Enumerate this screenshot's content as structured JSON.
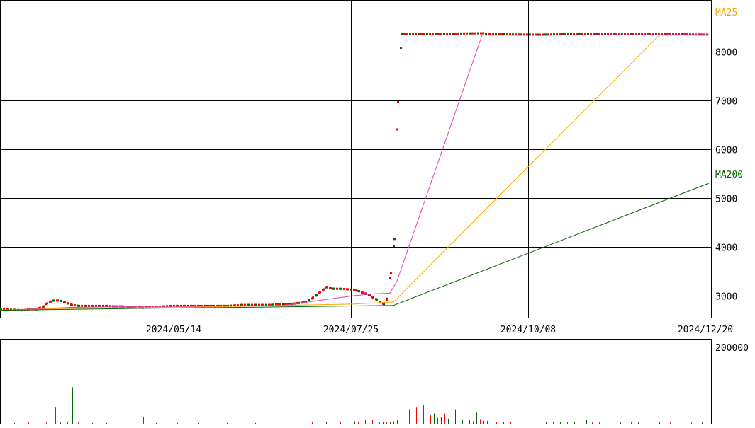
{
  "chart_data": [
    {
      "type": "candlestick",
      "panel": "price",
      "x_tick_labels": [
        "2024/05/14",
        "2024/07/25",
        "2024/10/08",
        "2024/12/20"
      ],
      "y_tick_labels": [
        "3000",
        "4000",
        "5000",
        "6000",
        "7000",
        "8000"
      ],
      "ylim": [
        2550,
        9050
      ],
      "grid": true,
      "legend": [
        "MA25",
        "MA200"
      ],
      "colors": {
        "up": "#ff0000",
        "down": "#006400",
        "ma_short": "#e040b0",
        "ma25": "#ffa500",
        "ma200": "#006400"
      },
      "prices": [
        [
          0,
          2720
        ],
        [
          10,
          2715
        ],
        [
          20,
          2710
        ],
        [
          30,
          2700
        ],
        [
          40,
          2720
        ],
        [
          50,
          2720
        ],
        [
          55,
          2750
        ],
        [
          60,
          2780
        ],
        [
          65,
          2840
        ],
        [
          70,
          2880
        ],
        [
          75,
          2900
        ],
        [
          80,
          2900
        ],
        [
          85,
          2890
        ],
        [
          90,
          2860
        ],
        [
          95,
          2840
        ],
        [
          100,
          2810
        ],
        [
          110,
          2790
        ],
        [
          120,
          2790
        ],
        [
          130,
          2790
        ],
        [
          140,
          2790
        ],
        [
          150,
          2790
        ],
        [
          160,
          2780
        ],
        [
          170,
          2780
        ],
        [
          180,
          2770
        ],
        [
          190,
          2770
        ],
        [
          200,
          2750
        ],
        [
          210,
          2770
        ],
        [
          220,
          2770
        ],
        [
          230,
          2780
        ],
        [
          240,
          2790
        ],
        [
          250,
          2790
        ],
        [
          260,
          2790
        ],
        [
          270,
          2790
        ],
        [
          280,
          2790
        ],
        [
          290,
          2790
        ],
        [
          300,
          2790
        ],
        [
          310,
          2790
        ],
        [
          320,
          2790
        ],
        [
          330,
          2800
        ],
        [
          340,
          2810
        ],
        [
          350,
          2810
        ],
        [
          360,
          2810
        ],
        [
          370,
          2810
        ],
        [
          380,
          2810
        ],
        [
          390,
          2820
        ],
        [
          400,
          2820
        ],
        [
          410,
          2830
        ],
        [
          420,
          2850
        ],
        [
          430,
          2870
        ],
        [
          440,
          2960
        ],
        [
          445,
          3010
        ],
        [
          450,
          3070
        ],
        [
          455,
          3130
        ],
        [
          460,
          3180
        ],
        [
          465,
          3150
        ],
        [
          470,
          3140
        ],
        [
          480,
          3140
        ],
        [
          490,
          3130
        ],
        [
          500,
          3120
        ],
        [
          505,
          3090
        ],
        [
          510,
          3060
        ],
        [
          515,
          3040
        ],
        [
          520,
          3010
        ],
        [
          525,
          2960
        ],
        [
          530,
          2920
        ],
        [
          535,
          2860
        ],
        [
          540,
          2830
        ],
        [
          545,
          2940
        ],
        [
          550,
          3460
        ],
        [
          555,
          4160
        ],
        [
          560,
          6960
        ],
        [
          565,
          8350
        ],
        [
          680,
          8370
        ],
        [
          690,
          8350
        ],
        [
          760,
          8340
        ],
        [
          800,
          8350
        ],
        [
          900,
          8360
        ],
        [
          1000,
          8340
        ]
      ],
      "ma_short": [
        [
          0,
          2700
        ],
        [
          100,
          2760
        ],
        [
          200,
          2780
        ],
        [
          300,
          2780
        ],
        [
          400,
          2800
        ],
        [
          460,
          2920
        ],
        [
          500,
          3000
        ],
        [
          530,
          3040
        ],
        [
          550,
          3050
        ],
        [
          560,
          3300
        ],
        [
          680,
          8330
        ],
        [
          1000,
          8340
        ]
      ],
      "ma25": [
        [
          0,
          2700
        ],
        [
          100,
          2740
        ],
        [
          300,
          2770
        ],
        [
          500,
          2830
        ],
        [
          555,
          2870
        ],
        [
          930,
          8330
        ],
        [
          1000,
          8330
        ]
      ],
      "ma200": [
        [
          0,
          2700
        ],
        [
          200,
          2740
        ],
        [
          400,
          2770
        ],
        [
          555,
          2800
        ],
        [
          1000,
          5300
        ]
      ]
    },
    {
      "type": "bar",
      "panel": "volume",
      "y_tick_labels": [
        "200000"
      ],
      "ylim": [
        0,
        200000
      ],
      "volumes": [
        [
          20,
          2000
        ],
        [
          40,
          3000
        ],
        [
          60,
          4000
        ],
        [
          65,
          3000
        ],
        [
          70,
          5000
        ],
        [
          78,
          38000
        ],
        [
          85,
          3000
        ],
        [
          95,
          4000
        ],
        [
          102,
          86000
        ],
        [
          110,
          3000
        ],
        [
          130,
          2000
        ],
        [
          150,
          2000
        ],
        [
          180,
          2000
        ],
        [
          202,
          16000
        ],
        [
          220,
          2000
        ],
        [
          250,
          2000
        ],
        [
          280,
          2000
        ],
        [
          320,
          2000
        ],
        [
          360,
          2000
        ],
        [
          400,
          3000
        ],
        [
          420,
          3000
        ],
        [
          440,
          4000
        ],
        [
          460,
          4000
        ],
        [
          480,
          5000
        ],
        [
          500,
          6000
        ],
        [
          505,
          4000
        ],
        [
          510,
          20000
        ],
        [
          515,
          9000
        ],
        [
          520,
          12000
        ],
        [
          525,
          9000
        ],
        [
          530,
          13000
        ],
        [
          535,
          5000
        ],
        [
          540,
          4000
        ],
        [
          545,
          3000
        ],
        [
          550,
          5000
        ],
        [
          555,
          6000
        ],
        [
          560,
          8000
        ],
        [
          568,
          202000
        ],
        [
          572,
          98000
        ],
        [
          577,
          34000
        ],
        [
          582,
          24000
        ],
        [
          587,
          38000
        ],
        [
          592,
          30000
        ],
        [
          597,
          44000
        ],
        [
          602,
          27000
        ],
        [
          607,
          21000
        ],
        [
          612,
          24000
        ],
        [
          617,
          14000
        ],
        [
          622,
          16000
        ],
        [
          627,
          24000
        ],
        [
          632,
          12000
        ],
        [
          637,
          9000
        ],
        [
          642,
          34000
        ],
        [
          647,
          7000
        ],
        [
          652,
          10000
        ],
        [
          657,
          30000
        ],
        [
          662,
          8000
        ],
        [
          667,
          6000
        ],
        [
          672,
          26000
        ],
        [
          677,
          11000
        ],
        [
          682,
          7000
        ],
        [
          687,
          7000
        ],
        [
          692,
          5000
        ],
        [
          700,
          5000
        ],
        [
          710,
          4000
        ],
        [
          720,
          4000
        ],
        [
          730,
          4000
        ],
        [
          740,
          4000
        ],
        [
          750,
          4000
        ],
        [
          760,
          4000
        ],
        [
          770,
          4000
        ],
        [
          780,
          4000
        ],
        [
          790,
          4000
        ],
        [
          800,
          4000
        ],
        [
          810,
          4000
        ],
        [
          822,
          24000
        ],
        [
          827,
          9000
        ],
        [
          835,
          3000
        ],
        [
          845,
          3000
        ],
        [
          860,
          6000
        ],
        [
          875,
          3000
        ],
        [
          890,
          4000
        ],
        [
          900,
          3000
        ],
        [
          915,
          3000
        ],
        [
          930,
          4000
        ],
        [
          945,
          3000
        ],
        [
          960,
          3000
        ],
        [
          975,
          3000
        ],
        [
          990,
          3000
        ]
      ]
    }
  ]
}
